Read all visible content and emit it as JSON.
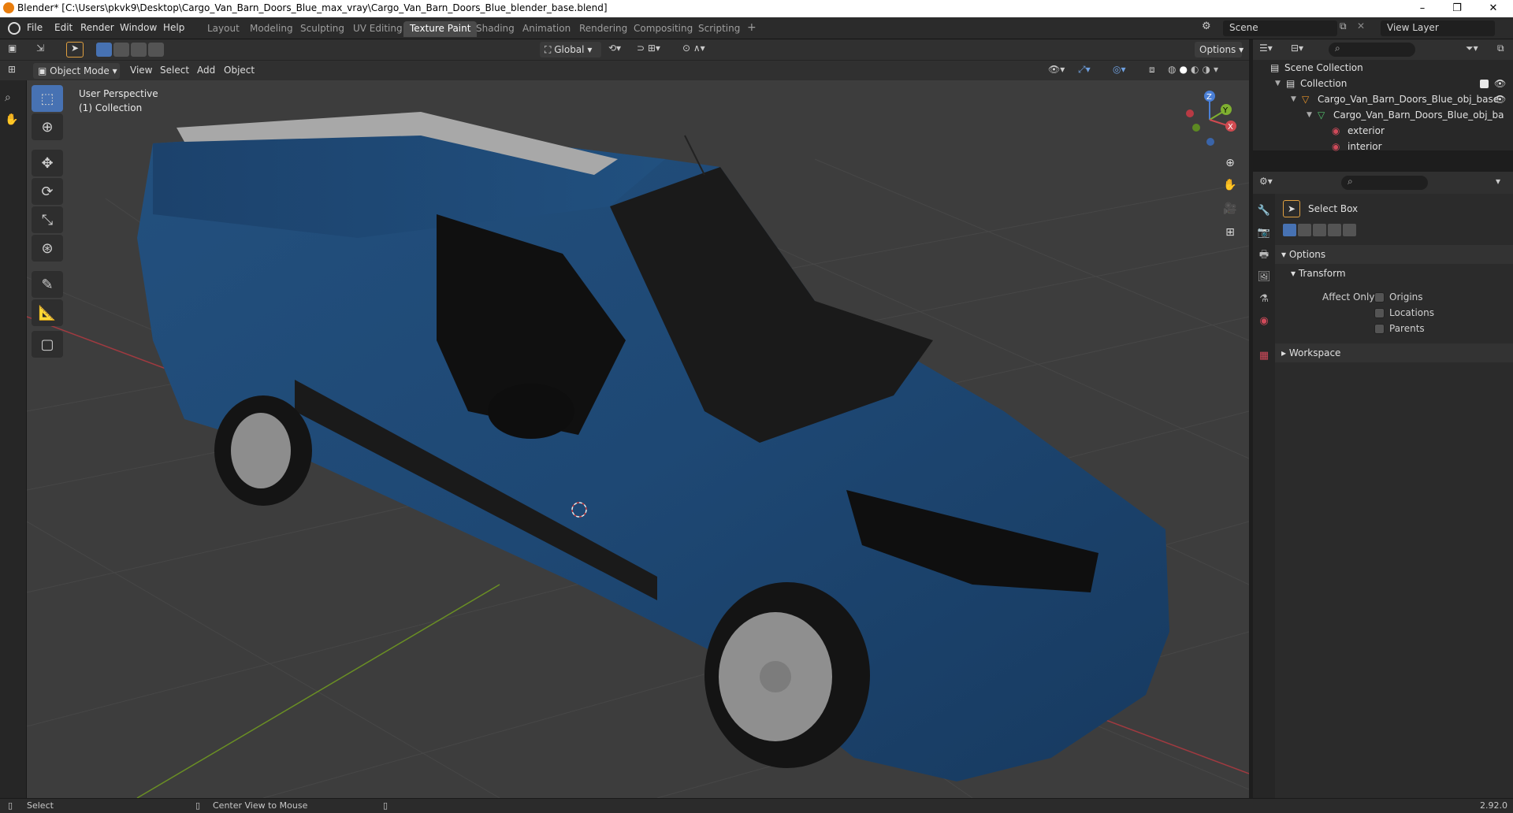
{
  "window": {
    "title": "Blender* [C:\\Users\\pkvk9\\Desktop\\Cargo_Van_Barn_Doors_Blue_max_vray\\Cargo_Van_Barn_Doors_Blue_blender_base.blend]",
    "controls": {
      "minimize": "–",
      "maximize": "❐",
      "close": "✕"
    }
  },
  "menu": {
    "items": [
      "File",
      "Edit",
      "Render",
      "Window",
      "Help"
    ]
  },
  "workspaces": {
    "tabs": [
      "Layout",
      "Modeling",
      "Sculpting",
      "UV Editing",
      "Texture Paint",
      "Shading",
      "Animation",
      "Rendering",
      "Compositing",
      "Scripting"
    ],
    "active": "Texture Paint",
    "add": "+"
  },
  "scene": {
    "label": "Scene",
    "view_layer": "View Layer"
  },
  "tool_header": {
    "orientation": "Global",
    "options": "Options"
  },
  "viewport_header": {
    "mode": "Object Mode",
    "menus": [
      "View",
      "Select",
      "Add",
      "Object"
    ]
  },
  "viewport": {
    "perspective": "User Perspective",
    "collection": "(1) Collection",
    "gizmo": {
      "x": "X",
      "y": "Y",
      "z": "Z"
    }
  },
  "tools": [
    "select-box",
    "cursor",
    "move",
    "rotate",
    "scale",
    "transform",
    "annotate",
    "measure",
    "add-cube"
  ],
  "outliner": {
    "rows": [
      {
        "label": "Scene Collection",
        "icon": "scene-collection-icon"
      },
      {
        "label": "Collection",
        "icon": "collection-icon"
      },
      {
        "label": "Cargo_Van_Barn_Doors_Blue_obj_base",
        "icon": "object-icon"
      },
      {
        "label": "Cargo_Van_Barn_Doors_Blue_obj_ba",
        "icon": "mesh-icon"
      },
      {
        "label": "exterior",
        "icon": "material-icon"
      },
      {
        "label": "interior",
        "icon": "material-icon"
      }
    ]
  },
  "properties": {
    "tool_name": "Select Box",
    "options_label": "Options",
    "transform_label": "Transform",
    "affect_only_label": "Affect Only",
    "affect_only": [
      {
        "label": "Origins",
        "checked": false
      },
      {
        "label": "Locations",
        "checked": false
      },
      {
        "label": "Parents",
        "checked": false
      }
    ],
    "workspace_label": "Workspace"
  },
  "statusbar": {
    "left": "Select",
    "middle": "Center View to Mouse",
    "version": "2.92.0"
  },
  "colors": {
    "accent": "#4772b3",
    "van_body": "#1f4a78",
    "viewport_bg": "#3d3d3d",
    "x_axis": "#c8444a",
    "y_axis": "#6f9e2a"
  }
}
